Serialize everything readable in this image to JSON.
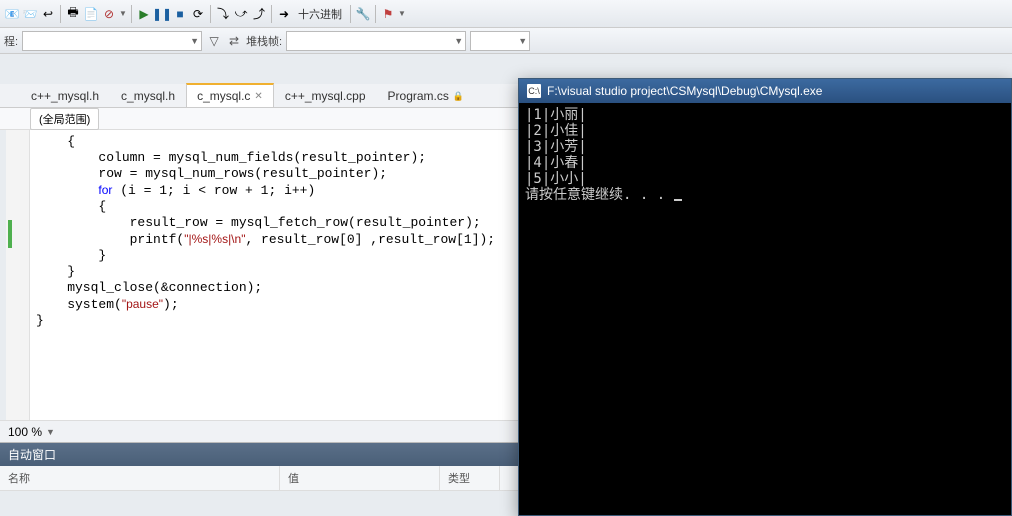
{
  "toolbar": {
    "hex_label": "十六进制"
  },
  "toolbar2": {
    "process_label": "程:",
    "stack_label": "堆栈帧:"
  },
  "tabs": [
    {
      "label": "c++_mysql.h",
      "active": false,
      "close": false
    },
    {
      "label": "c_mysql.h",
      "active": false,
      "close": false
    },
    {
      "label": "c_mysql.c",
      "active": true,
      "close": true
    },
    {
      "label": "c++_mysql.cpp",
      "active": false,
      "close": false
    },
    {
      "label": "Program.cs",
      "active": false,
      "lock": true
    }
  ],
  "scope": "(全局范围)",
  "code_lines": [
    "    {",
    "        column = mysql_num_fields(result_pointer);",
    "        row = mysql_num_rows(result_pointer);",
    "        for (i = 1; i < row + 1; i++)",
    "        {",
    "            result_row = mysql_fetch_row(result_pointer);",
    "            printf(\"|%s|%s|\\n\", result_row[0] ,result_row[1]);",
    "        }",
    "    }",
    "    mysql_close(&connection);",
    "    system(\"pause\");",
    "}"
  ],
  "zoom": "100 %",
  "panel": {
    "title": "自动窗口",
    "cols": [
      "名称",
      "值",
      "类型"
    ]
  },
  "console": {
    "title": "F:\\visual studio project\\CSMysql\\Debug\\CMysql.exe",
    "lines": [
      "|1|小丽|",
      "|2|小佳|",
      "|3|小芳|",
      "|4|小春|",
      "|5|小小|",
      "请按任意键继续. . . "
    ]
  }
}
